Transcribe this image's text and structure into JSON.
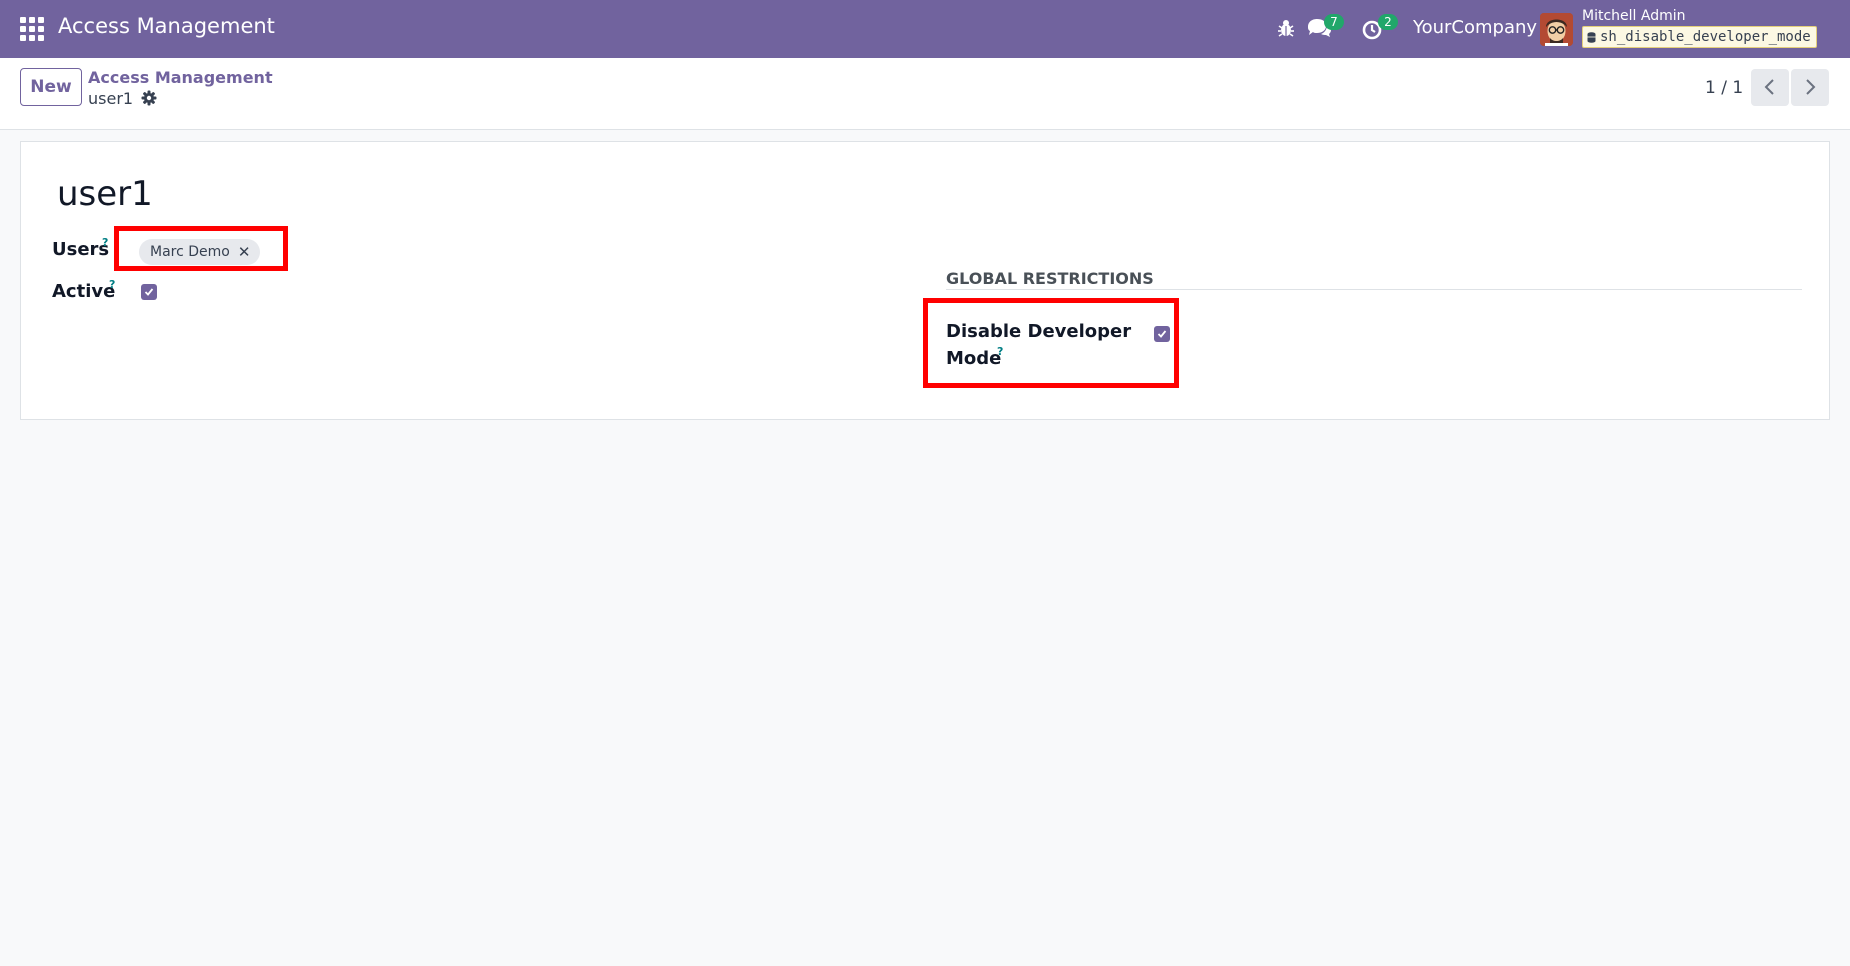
{
  "navbar": {
    "app_title": "Access Management",
    "messages_count": "7",
    "activities_count": "2",
    "company": "YourCompany",
    "user_name": "Mitchell Admin",
    "database": "sh_disable_developer_mode",
    "brand_color": "#71639e"
  },
  "control_panel": {
    "new_button": "New",
    "breadcrumb_parent": "Access Management",
    "breadcrumb_current": "user1",
    "pager_value": "1 / 1"
  },
  "form": {
    "title": "user1",
    "users_label": "Users",
    "users_tags": [
      "Marc Demo"
    ],
    "active_label": "Active",
    "active_checked": true,
    "help_mark": "?",
    "section_title": "GLOBAL RESTRICTIONS",
    "disable_dev_label_line1": "Disable Developer",
    "disable_dev_label_line2": "Mode",
    "disable_dev_checked": true
  },
  "icons": {
    "apps": "apps-grid-icon",
    "debug": "bug-icon",
    "messages": "chat-icon",
    "activities": "clock-icon",
    "record_actions": "gear-icon",
    "pager_prev": "chevron-left-icon",
    "pager_next": "chevron-right-icon",
    "tag_remove": "close-icon"
  },
  "annotation_color": "#ff0000"
}
